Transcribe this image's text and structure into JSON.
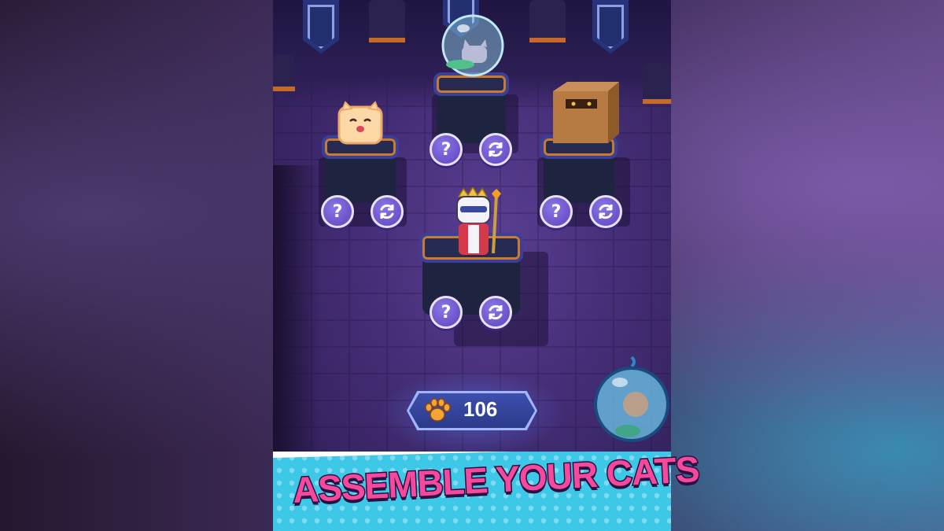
{
  "game": {
    "currency": {
      "icon": "paw-icon",
      "value": "106"
    },
    "headline": "ASSEMBLE YOUR CATS",
    "pedestals": [
      {
        "id": "bubble-cat",
        "info_icon": "question-icon",
        "swap_icon": "refresh-icon"
      },
      {
        "id": "toast-cat",
        "info_icon": "question-icon",
        "swap_icon": "refresh-icon"
      },
      {
        "id": "box-cat",
        "info_icon": "question-icon",
        "swap_icon": "refresh-icon"
      },
      {
        "id": "king-cat",
        "info_icon": "question-icon",
        "swap_icon": "refresh-icon"
      }
    ],
    "colors": {
      "button_purple": "#6b52c8",
      "headline_pink": "#f6489c",
      "banner_cyan": "#3ec8e8",
      "pedestal_trim_orange": "#c87a30"
    }
  }
}
